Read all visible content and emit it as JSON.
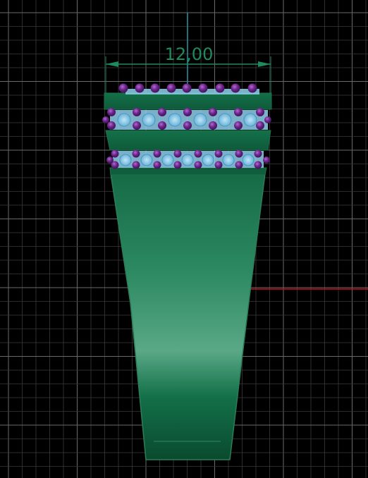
{
  "viewport": {
    "background": "#000000",
    "grid_minor_color": "#3a3a3a",
    "grid_major_color": "#6a6a6a",
    "axis_y_color": "#1f8fa0",
    "axis_x_color": "#c0141e"
  },
  "dimension": {
    "label": "12,00",
    "color": "#1f8a5c"
  },
  "ring": {
    "body_color_dark": "#0d4d31",
    "body_color_light": "#4ea07c",
    "edge_color": "#1e6e4a",
    "gem_color": "#5e1f7a",
    "gem_highlight": "#9a4fbf",
    "setting_color": "#7fc6e6"
  }
}
